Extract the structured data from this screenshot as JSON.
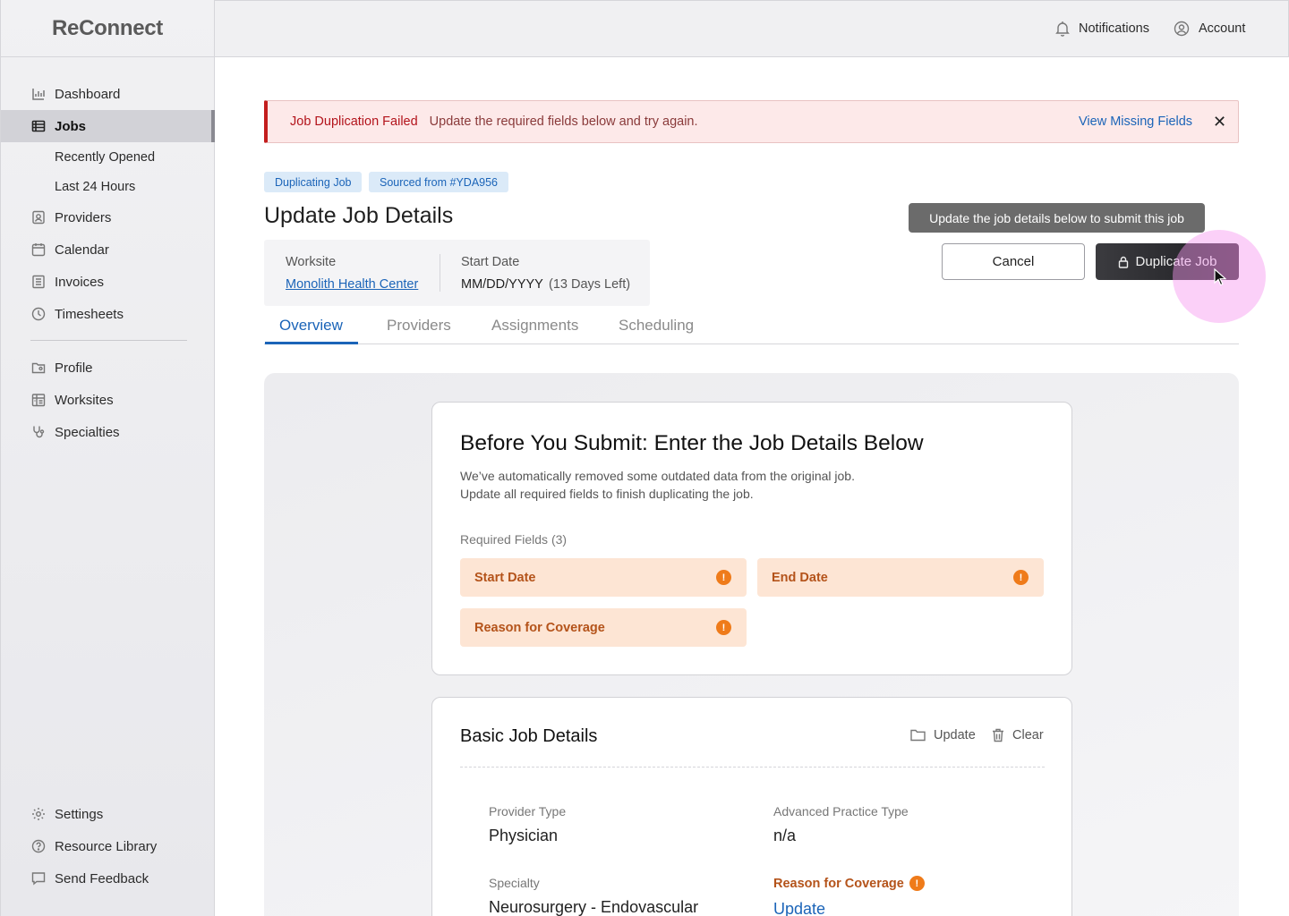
{
  "app": {
    "logo": "ReConnect"
  },
  "header": {
    "notifications_label": "Notifications",
    "account_label": "Account"
  },
  "sidebar": {
    "items": [
      {
        "label": "Dashboard",
        "icon": "bar-chart-icon"
      },
      {
        "label": "Jobs",
        "icon": "list-icon",
        "active": true
      },
      {
        "label": "Providers",
        "icon": "id-badge-icon"
      },
      {
        "label": "Calendar",
        "icon": "calendar-icon"
      },
      {
        "label": "Invoices",
        "icon": "invoice-icon"
      },
      {
        "label": "Timesheets",
        "icon": "clock-icon"
      },
      {
        "label": "Profile",
        "icon": "folder-user-icon"
      },
      {
        "label": "Worksites",
        "icon": "building-icon"
      },
      {
        "label": "Specialties",
        "icon": "stethoscope-icon"
      },
      {
        "label": "Settings",
        "icon": "gear-icon"
      },
      {
        "label": "Resource Library",
        "icon": "help-circle-icon"
      },
      {
        "label": "Send Feedback",
        "icon": "message-icon"
      }
    ],
    "subitems": [
      "Recently Opened",
      "Last 24 Hours"
    ]
  },
  "alert": {
    "title": "Job Duplication Failed",
    "message": "Update the required fields below and try again.",
    "link": "View Missing Fields",
    "close": "✕"
  },
  "tags": [
    "Duplicating Job",
    "Sourced from #YDA956"
  ],
  "page_title": "Update Job Details",
  "info": {
    "worksite_label": "Worksite",
    "worksite_value": "Monolith Health Center",
    "start_label": "Start Date",
    "start_value": "MM/DD/YYYY",
    "start_note": "(13 Days Left)"
  },
  "tooltip": "Update the job details below to submit this job",
  "buttons": {
    "cancel": "Cancel",
    "duplicate": "Duplicate Job"
  },
  "tabs": [
    "Overview",
    "Providers",
    "Assignments",
    "Scheduling"
  ],
  "submit_card": {
    "title": "Before You Submit: Enter the Job Details Below",
    "desc_line1": "We’ve automatically removed some outdated data from the original job.",
    "desc_line2": "Update all required fields to finish duplicating the job.",
    "required_label": "Required Fields (3)",
    "required_fields": [
      "Start Date",
      "End Date",
      "Reason for Coverage"
    ]
  },
  "basic_card": {
    "title": "Basic Job Details",
    "update_label": "Update",
    "clear_label": "Clear",
    "provider_type_label": "Provider Type",
    "provider_type_value": "Physician",
    "adv_practice_label": "Advanced Practice Type",
    "adv_practice_value": "n/a",
    "specialty_label": "Specialty",
    "specialty_value": "Neurosurgery - Endovascular",
    "reason_label": "Reason for Coverage",
    "reason_action": "Update"
  },
  "colors": {
    "accent": "#1b64b8",
    "error": "#c31d1d",
    "warning": "#ef7b1a"
  }
}
